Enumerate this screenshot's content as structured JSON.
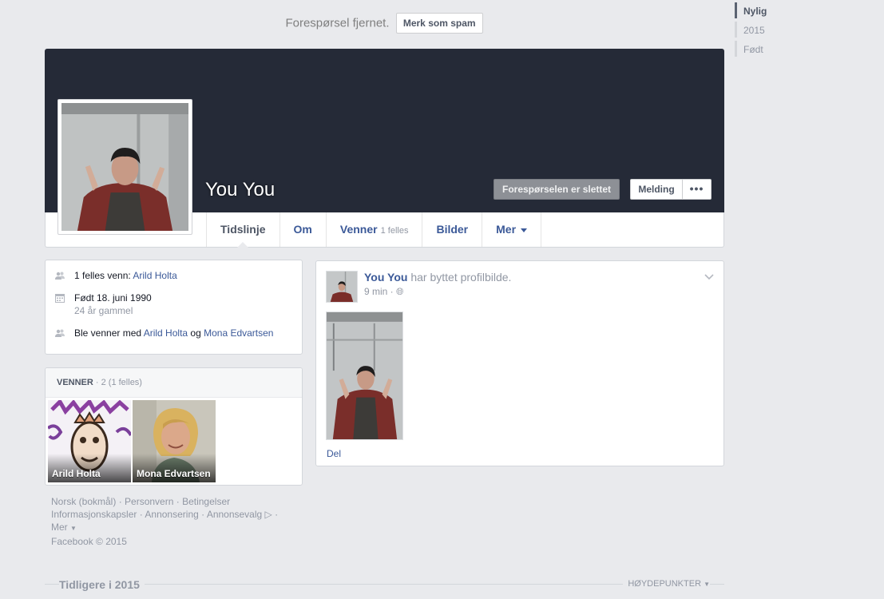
{
  "notice": {
    "text": "Forespørsel fjernet.",
    "spam_button": "Merk som spam"
  },
  "scrubber": {
    "items": [
      "Nylig",
      "2015",
      "Født"
    ]
  },
  "profile": {
    "name": "You You",
    "request_button": "Forespørselen er slettet",
    "message_button": "Melding",
    "more_button": "•••"
  },
  "tabs": {
    "timeline": "Tidslinje",
    "about": "Om",
    "friends": "Venner",
    "friends_sub": "1 felles",
    "photos": "Bilder",
    "more": "Mer"
  },
  "intro": {
    "mutual_prefix": "1 felles venn: ",
    "mutual_name": "Arild Holta",
    "born": "Født 18. juni 1990",
    "age": "24 år gammel",
    "became_friends_prefix": "Ble venner med ",
    "friend_a": "Arild Holta",
    "and": " og ",
    "friend_b": "Mona Edvartsen"
  },
  "friends_box": {
    "title": "VENNER",
    "count": " · 2 (1 felles)",
    "items": [
      {
        "name": "Arild Holta"
      },
      {
        "name": "Mona Edvartsen"
      }
    ]
  },
  "footer": {
    "line1": [
      "Norsk (bokmål)",
      "Personvern",
      "Betingelser"
    ],
    "line2": [
      "Informasjonskapsler",
      "Annonsering",
      "Annonsevalg"
    ],
    "more": "Mer",
    "copyright": "Facebook © 2015"
  },
  "post": {
    "author": "You You",
    "action": " har byttet profilbilde.",
    "time": "9 min · ",
    "share": "Del"
  },
  "bottom": {
    "left": "Tidligere i 2015",
    "right": "HØYDEPUNKTER"
  },
  "colors": {
    "link": "#3b5998",
    "cover": "#252a37",
    "background": "#e9eaed"
  }
}
